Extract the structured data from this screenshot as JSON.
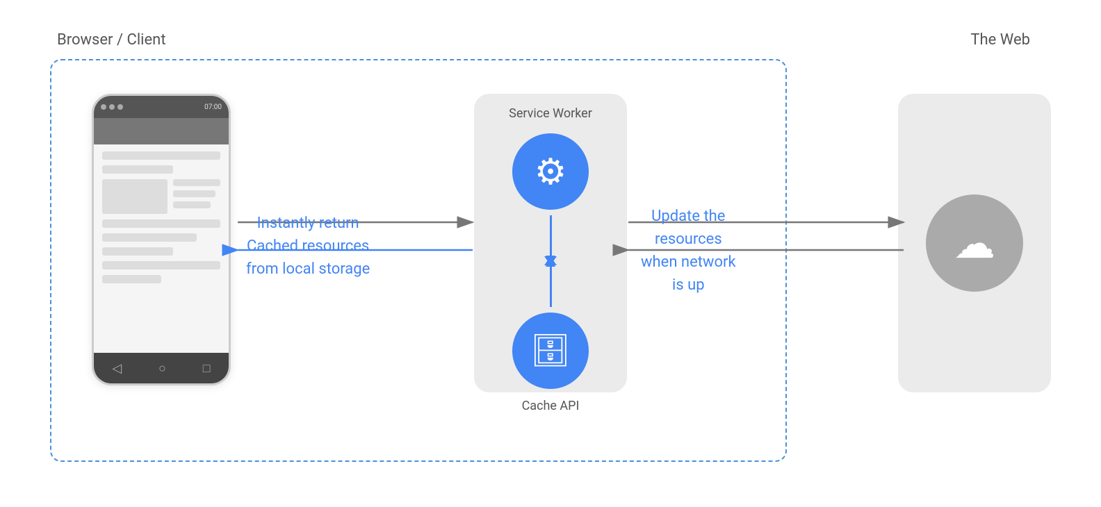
{
  "labels": {
    "browser_client": "Browser / Client",
    "the_web": "The Web",
    "service_worker": "Service Worker",
    "cache_api": "Cache API",
    "instantly_return": "Instantly return",
    "cached_resources": "Cached resources",
    "from_local_storage": "from local storage",
    "update_the": "Update the",
    "resources": "resources",
    "when_network": "when network",
    "is_up": "is up"
  },
  "colors": {
    "blue": "#4285F4",
    "dashed_border": "#4A90D9",
    "box_bg": "#ebebeb",
    "cloud_bg": "#aaa",
    "phone_statusbar": "#555",
    "arrow_text": "#4285F4"
  },
  "phone": {
    "nav_back": "◁",
    "nav_home": "○",
    "nav_recent": "□"
  }
}
